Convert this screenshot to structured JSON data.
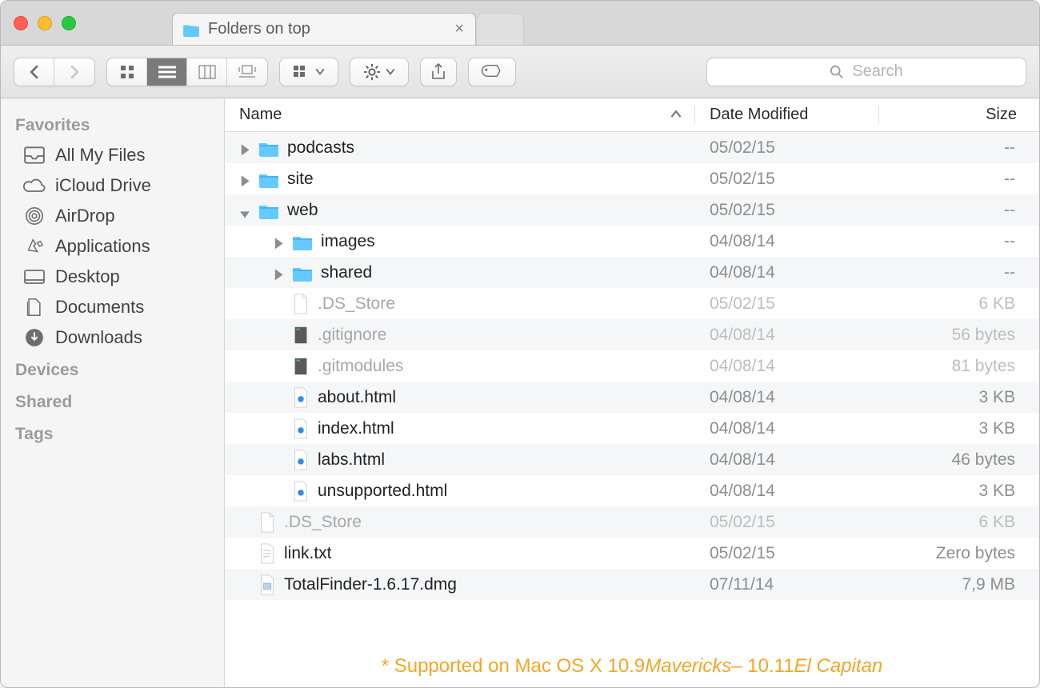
{
  "window": {
    "tab_title": "Folders on top"
  },
  "search": {
    "placeholder": "Search"
  },
  "sidebar": {
    "sections": [
      {
        "title": "Favorites",
        "items": [
          {
            "label": "All My Files",
            "icon": "tray"
          },
          {
            "label": "iCloud Drive",
            "icon": "cloud"
          },
          {
            "label": "AirDrop",
            "icon": "airdrop"
          },
          {
            "label": "Applications",
            "icon": "apps"
          },
          {
            "label": "Desktop",
            "icon": "desktop"
          },
          {
            "label": "Documents",
            "icon": "documents"
          },
          {
            "label": "Downloads",
            "icon": "downloads"
          }
        ]
      },
      {
        "title": "Devices",
        "items": []
      },
      {
        "title": "Shared",
        "items": []
      },
      {
        "title": "Tags",
        "items": []
      }
    ]
  },
  "columns": {
    "name": "Name",
    "date": "Date Modified",
    "size": "Size"
  },
  "files": [
    {
      "depth": 0,
      "expand": "closed",
      "icon": "folder",
      "name": "podcasts",
      "date": "05/02/15",
      "size": "--"
    },
    {
      "depth": 0,
      "expand": "closed",
      "icon": "folder",
      "name": "site",
      "date": "05/02/15",
      "size": "--"
    },
    {
      "depth": 0,
      "expand": "open",
      "icon": "folder",
      "name": "web",
      "date": "05/02/15",
      "size": "--"
    },
    {
      "depth": 1,
      "expand": "closed",
      "icon": "folder",
      "name": "images",
      "date": "04/08/14",
      "size": "--"
    },
    {
      "depth": 1,
      "expand": "closed",
      "icon": "folder",
      "name": "shared",
      "date": "04/08/14",
      "size": "--"
    },
    {
      "depth": 1,
      "expand": "none",
      "icon": "blank",
      "name": ".DS_Store",
      "date": "05/02/15",
      "size": "6 KB",
      "dim": true
    },
    {
      "depth": 1,
      "expand": "none",
      "icon": "exec",
      "name": ".gitignore",
      "date": "04/08/14",
      "size": "56 bytes",
      "dim": true
    },
    {
      "depth": 1,
      "expand": "none",
      "icon": "exec",
      "name": ".gitmodules",
      "date": "04/08/14",
      "size": "81 bytes",
      "dim": true
    },
    {
      "depth": 1,
      "expand": "none",
      "icon": "html",
      "name": "about.html",
      "date": "04/08/14",
      "size": "3 KB"
    },
    {
      "depth": 1,
      "expand": "none",
      "icon": "html",
      "name": "index.html",
      "date": "04/08/14",
      "size": "3 KB"
    },
    {
      "depth": 1,
      "expand": "none",
      "icon": "html",
      "name": "labs.html",
      "date": "04/08/14",
      "size": "46 bytes"
    },
    {
      "depth": 1,
      "expand": "none",
      "icon": "html",
      "name": "unsupported.html",
      "date": "04/08/14",
      "size": "3 KB"
    },
    {
      "depth": 0,
      "expand": "none",
      "icon": "blank",
      "name": ".DS_Store",
      "date": "05/02/15",
      "size": "6 KB",
      "dim": true
    },
    {
      "depth": 0,
      "expand": "none",
      "icon": "txt",
      "name": "link.txt",
      "date": "05/02/15",
      "size": "Zero bytes"
    },
    {
      "depth": 0,
      "expand": "none",
      "icon": "dmg",
      "name": "TotalFinder-1.6.17.dmg",
      "date": "07/11/14",
      "size": "7,9 MB"
    }
  ],
  "footer": {
    "prefix": "* Supported on Mac OS X 10.9 ",
    "italic1": "Mavericks",
    "mid": " – 10.11 ",
    "italic2": "El Capitan"
  }
}
